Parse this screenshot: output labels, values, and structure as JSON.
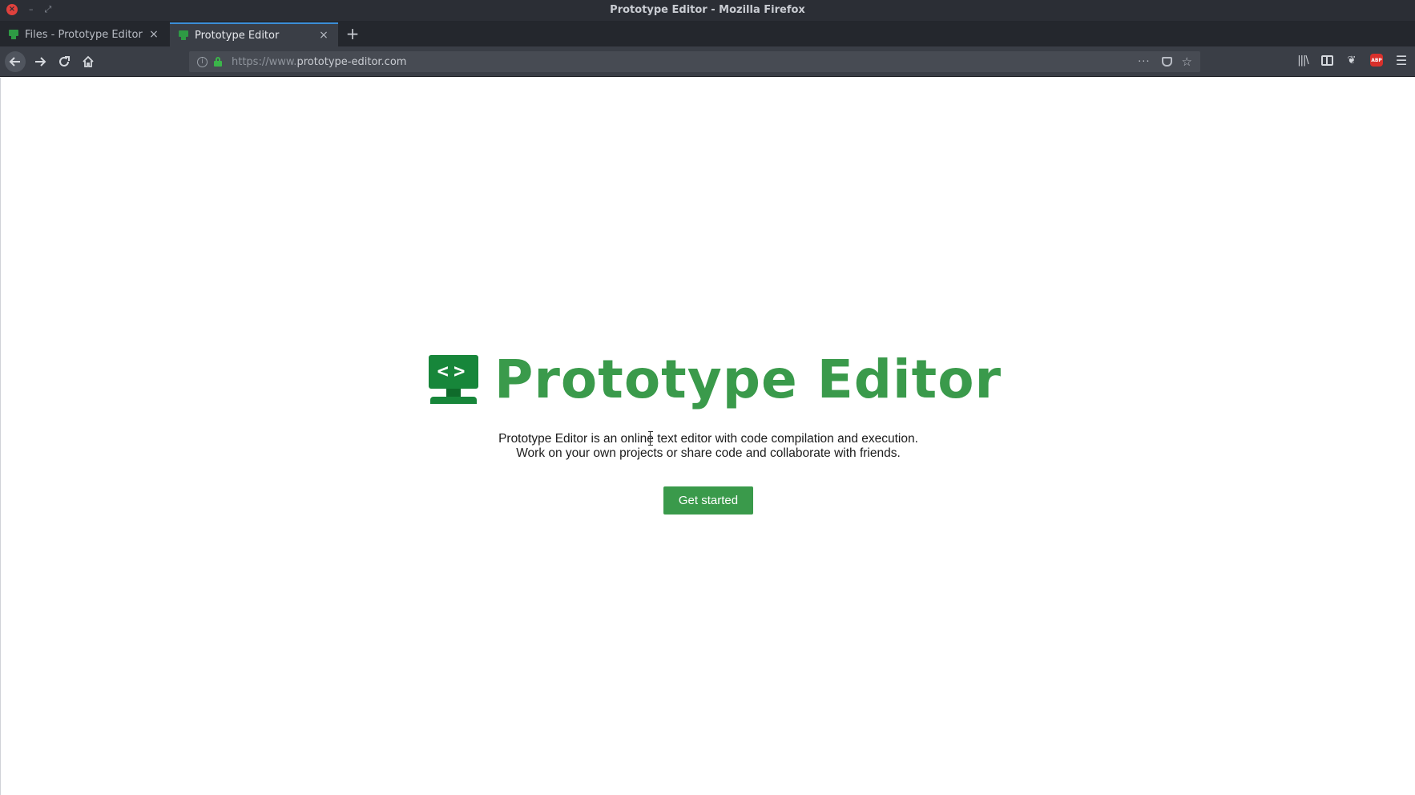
{
  "window": {
    "title": "Prototype Editor - Mozilla Firefox"
  },
  "tabs": [
    {
      "label": "Files - Prototype Editor",
      "active": false
    },
    {
      "label": "Prototype Editor",
      "active": true
    }
  ],
  "tab_close_glyph": "×",
  "new_tab_glyph": "+",
  "navbar": {
    "url_prefix": "https://www.",
    "url_domain": "prototype-editor.com",
    "page_actions_glyph": "···",
    "star_glyph": "☆"
  },
  "icons": {
    "back": "arrow-left-icon",
    "forward": "arrow-right-icon",
    "reload": "reload-icon",
    "home": "home-icon",
    "library": "library-icon",
    "sidebar": "sidebar-icon",
    "extension": "extension-icon",
    "adblock": "adblock-icon",
    "menu": "hamburger-menu-icon"
  },
  "page": {
    "brand_title": "Prototype Editor",
    "logo_glyph": "<>",
    "tagline_line1": "Prototype Editor is an online text editor with code compilation and execution.",
    "tagline_line2": "Work on your own projects or share code and collaborate with friends.",
    "cta_label": "Get started"
  },
  "colors": {
    "brand_green": "#3a9a4b",
    "logo_dark_green": "#17863a",
    "browser_dark": "#2b2e35",
    "active_tab_accent": "#3b8ed7"
  }
}
